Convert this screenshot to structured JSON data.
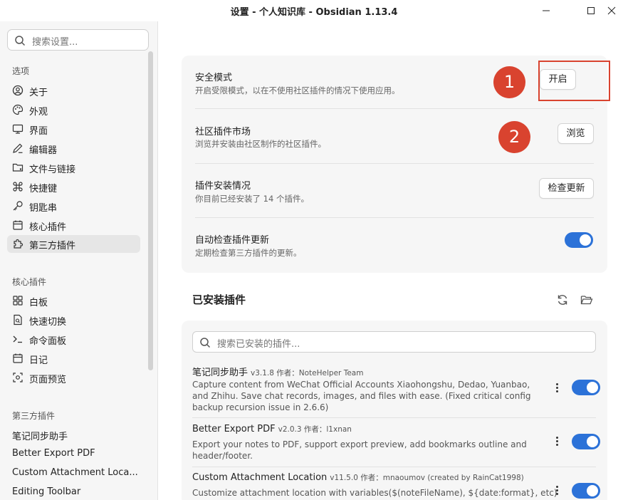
{
  "window": {
    "title": "设置 - 个人知识库 - Obsidian 1.13.4"
  },
  "sidebar": {
    "search_placeholder": "搜索设置...",
    "section_options": "选项",
    "options": [
      {
        "label": "关于",
        "icon": "user-circle-icon"
      },
      {
        "label": "外观",
        "icon": "palette-icon"
      },
      {
        "label": "界面",
        "icon": "monitor-icon"
      },
      {
        "label": "编辑器",
        "icon": "pencil-icon"
      },
      {
        "label": "文件与链接",
        "icon": "folder-icon"
      },
      {
        "label": "快捷键",
        "icon": "command-icon"
      },
      {
        "label": "钥匙串",
        "icon": "key-icon"
      },
      {
        "label": "核心插件",
        "icon": "calendar-icon"
      },
      {
        "label": "第三方插件",
        "icon": "puzzle-icon"
      }
    ],
    "active_item": "第三方插件",
    "section_core": "核心插件",
    "core": [
      {
        "label": "白板",
        "icon": "canvas-icon"
      },
      {
        "label": "快速切换",
        "icon": "file-search-icon"
      },
      {
        "label": "命令面板",
        "icon": "terminal-icon"
      },
      {
        "label": "日记",
        "icon": "calendar-icon"
      },
      {
        "label": "页面预览",
        "icon": "preview-icon"
      }
    ],
    "section_third": "第三方插件",
    "third": [
      "笔记同步助手",
      "Better Export PDF",
      "Custom Attachment Loca...",
      "Editing Toolbar"
    ]
  },
  "settings": {
    "safe_mode": {
      "title": "安全模式",
      "desc": "开启受限模式，以在不使用社区插件的情况下使用应用。",
      "button": "开启"
    },
    "community": {
      "title": "社区插件市场",
      "desc": "浏览并安装由社区制作的社区插件。",
      "button": "浏览"
    },
    "install_status": {
      "title": "插件安装情况",
      "desc": "你目前已经安装了 14 个插件。",
      "button": "检查更新"
    },
    "auto_check": {
      "title": "自动检查插件更新",
      "desc": "定期检查第三方插件的更新。",
      "enabled": true
    }
  },
  "annotations": {
    "badge1": "1",
    "badge2": "2",
    "color": "#d9432f"
  },
  "installed": {
    "title": "已安装插件",
    "search_placeholder": "搜索已安装的插件...",
    "plugins": [
      {
        "name": "笔记同步助手",
        "meta": "v3.1.8 作者：NoteHelper Team",
        "desc": "Capture content from WeChat Official Accounts Xiaohongshu, Dedao, Yuanbao, and Zhihu. Save chat records, images, and files with ease. (Fixed critical config backup recursion issue in 2.6.6)",
        "enabled": true
      },
      {
        "name": "Better Export PDF",
        "meta": "v2.0.3 作者：l1xnan",
        "desc": "Export your notes to PDF, support export preview, add bookmarks outline and header/footer.",
        "enabled": true
      },
      {
        "name": "Custom Attachment Location",
        "meta": "v11.5.0 作者：mnaoumov (created by RainCat1998)",
        "desc": "Customize attachment location with variables($(noteFileName), ${date:format}, etc)",
        "enabled": true
      }
    ]
  },
  "accent_color": "#2c72d8"
}
